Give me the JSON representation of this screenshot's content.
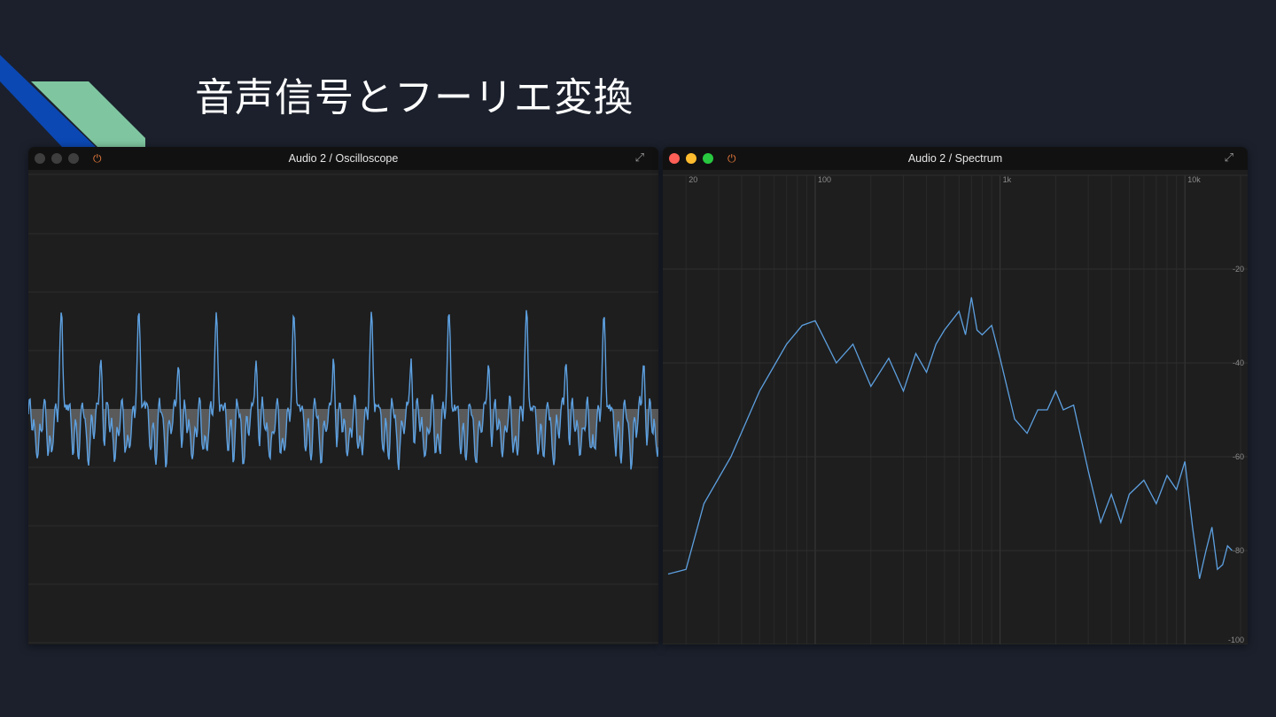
{
  "slide": {
    "title": "音声信号とフーリエ変換",
    "colors": {
      "background": "#1b202c",
      "accent_blue": "#0b48b3",
      "accent_green": "#7fc6a0"
    }
  },
  "oscilloscope": {
    "window_title": "Audio 2 / Oscilloscope",
    "traffic_lights": [
      "inactive",
      "inactive",
      "inactive"
    ],
    "icons": [
      "power-icon",
      "expand-icon"
    ],
    "trace_color": "#5da0e0",
    "fill_color": "#5a5a5a"
  },
  "spectrum": {
    "window_title": "Audio 2 / Spectrum",
    "traffic_lights": [
      "close",
      "minimize",
      "zoom"
    ],
    "icons": [
      "power-icon",
      "expand-icon"
    ],
    "chart_data": {
      "type": "line",
      "x_scale": "log",
      "x_tick_labels": [
        "20",
        "100",
        "1k",
        "10k"
      ],
      "x_ticks": [
        20,
        100,
        1000,
        10000
      ],
      "y_tick_labels": [
        "-20",
        "-40",
        "-60",
        "-80",
        "-100"
      ],
      "y_ticks": [
        -20,
        -40,
        -60,
        -80,
        -100
      ],
      "xlim": [
        16,
        20000
      ],
      "ylim": [
        -100,
        0
      ],
      "series": [
        {
          "color": "#5da0e0",
          "points": [
            [
              16,
              -85
            ],
            [
              20,
              -84
            ],
            [
              25,
              -70
            ],
            [
              35,
              -60
            ],
            [
              50,
              -46
            ],
            [
              70,
              -36
            ],
            [
              85,
              -32
            ],
            [
              100,
              -31
            ],
            [
              130,
              -40
            ],
            [
              160,
              -36
            ],
            [
              200,
              -45
            ],
            [
              250,
              -39
            ],
            [
              300,
              -46
            ],
            [
              350,
              -38
            ],
            [
              400,
              -42
            ],
            [
              450,
              -36
            ],
            [
              500,
              -33
            ],
            [
              600,
              -29
            ],
            [
              650,
              -34
            ],
            [
              700,
              -26
            ],
            [
              750,
              -33
            ],
            [
              800,
              -34
            ],
            [
              900,
              -32
            ],
            [
              1000,
              -39
            ],
            [
              1200,
              -52
            ],
            [
              1400,
              -55
            ],
            [
              1600,
              -50
            ],
            [
              1800,
              -50
            ],
            [
              2000,
              -46
            ],
            [
              2200,
              -50
            ],
            [
              2500,
              -49
            ],
            [
              3000,
              -63
            ],
            [
              3500,
              -74
            ],
            [
              4000,
              -68
            ],
            [
              4500,
              -74
            ],
            [
              5000,
              -68
            ],
            [
              6000,
              -65
            ],
            [
              7000,
              -70
            ],
            [
              8000,
              -64
            ],
            [
              9000,
              -67
            ],
            [
              10000,
              -61
            ],
            [
              11000,
              -75
            ],
            [
              12000,
              -86
            ],
            [
              13000,
              -80
            ],
            [
              14000,
              -75
            ],
            [
              15000,
              -84
            ],
            [
              16000,
              -83
            ],
            [
              17000,
              -79
            ],
            [
              18000,
              -80
            ]
          ]
        }
      ]
    }
  }
}
